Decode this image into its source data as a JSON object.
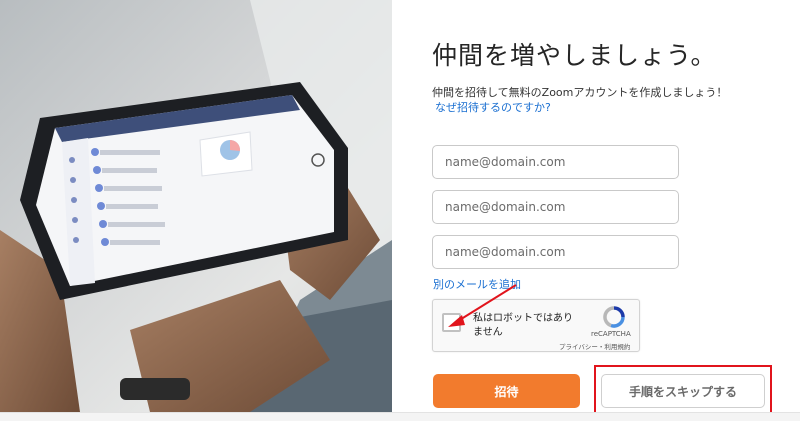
{
  "header": {
    "title": "仲間を増やしましょう。"
  },
  "intro": {
    "description": "仲間を招待して無料のZoomアカウントを作成しましょう！",
    "why_link": "なぜ招待するのですか?"
  },
  "emails": [
    {
      "value": "",
      "placeholder": "name@domain.com"
    },
    {
      "value": "",
      "placeholder": "name@domain.com"
    },
    {
      "value": "",
      "placeholder": "name@domain.com"
    }
  ],
  "add_email_link": "別のメールを追加",
  "captcha": {
    "label": "私はロボットではありません",
    "brand": "reCAPTCHA",
    "terms": "プライバシー・利用規約",
    "checked": false
  },
  "actions": {
    "invite_label": "招待",
    "skip_label": "手順をスキップする"
  },
  "colors": {
    "accent_orange": "#f27b2d",
    "link_blue": "#1a6fd1",
    "annotation_red": "#e1141c"
  },
  "icons": [
    "recaptcha-logo-icon",
    "annotation-arrow-icon"
  ]
}
